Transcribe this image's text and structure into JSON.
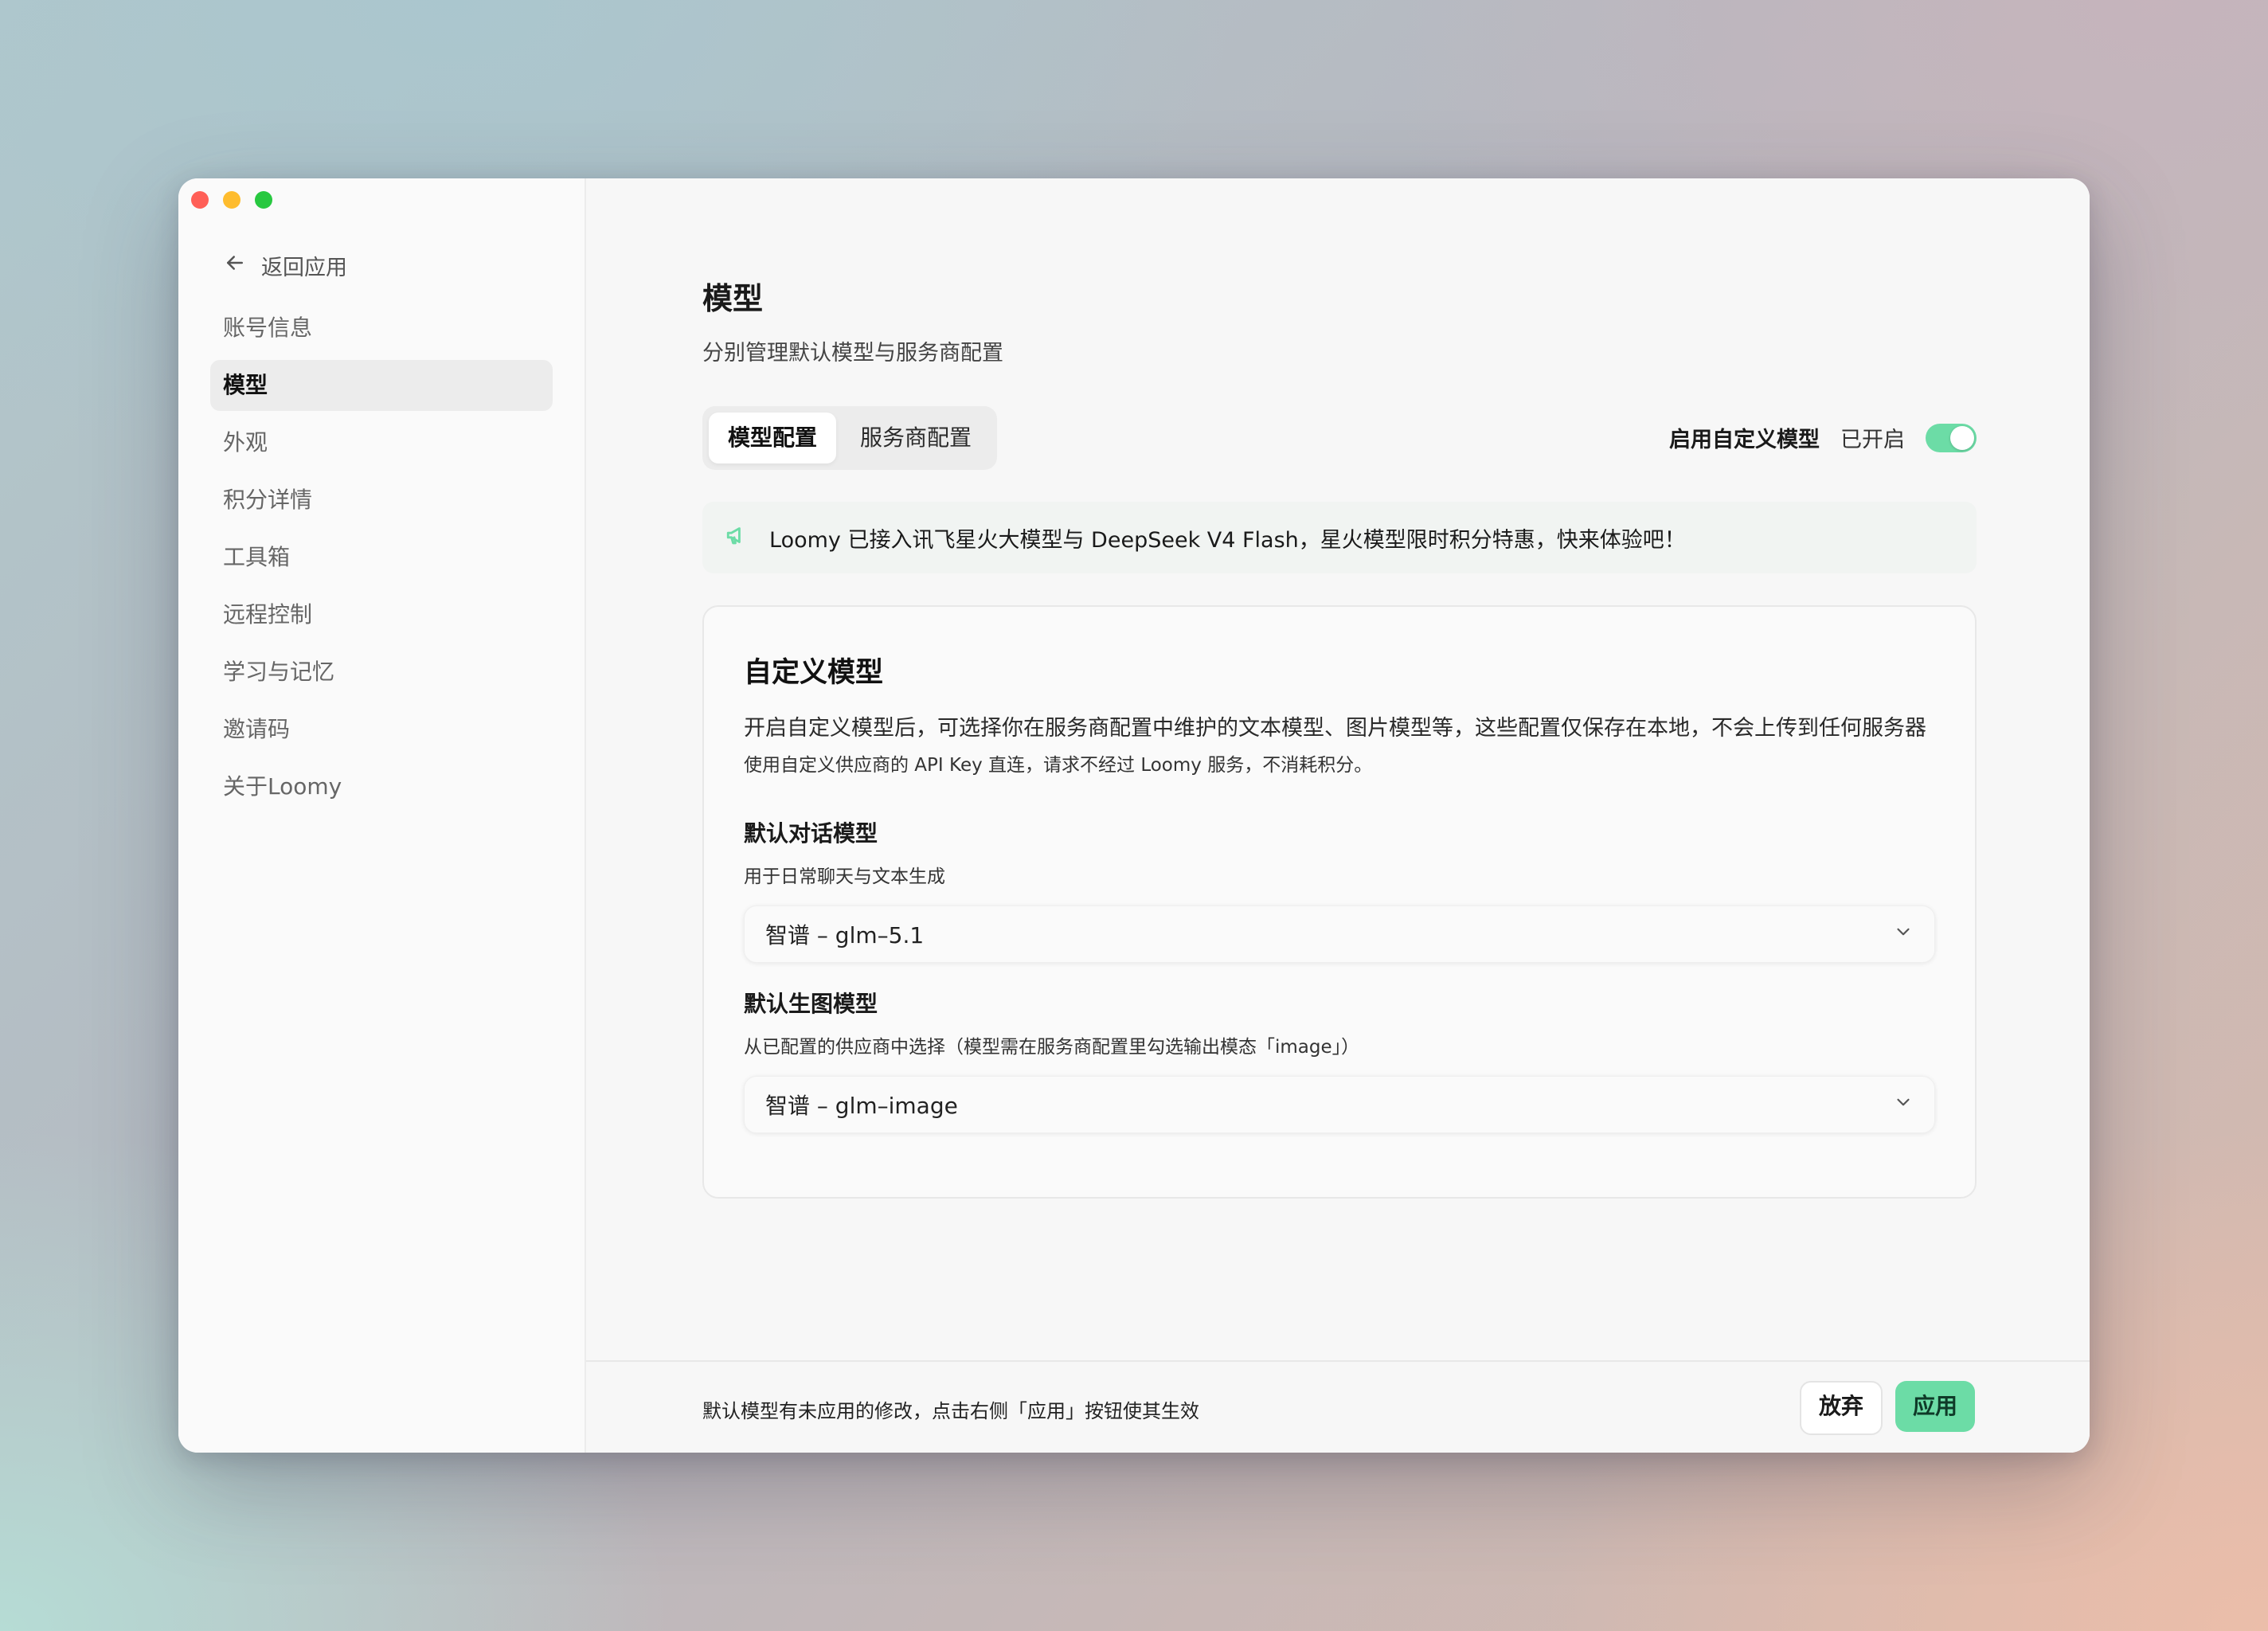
{
  "sidebar": {
    "back_label": "返回应用",
    "items": [
      {
        "label": "账号信息"
      },
      {
        "label": "模型"
      },
      {
        "label": "外观"
      },
      {
        "label": "积分详情"
      },
      {
        "label": "工具箱"
      },
      {
        "label": "远程控制"
      },
      {
        "label": "学习与记忆"
      },
      {
        "label": "邀请码"
      },
      {
        "label": "关于Loomy"
      }
    ],
    "active_index": 1
  },
  "header": {
    "title": "模型",
    "subtitle": "分别管理默认模型与服务商配置"
  },
  "tabs": [
    {
      "label": "模型配置",
      "active": true
    },
    {
      "label": "服务商配置",
      "active": false
    }
  ],
  "custom_toggle": {
    "label": "启用自定义模型",
    "state_text": "已开启",
    "enabled": true
  },
  "notice": {
    "icon": "megaphone-icon",
    "text": "Loomy 已接入讯飞星火大模型与 DeepSeek V4 Flash，星火模型限时积分特惠，快来体验吧！"
  },
  "card": {
    "title": "自定义模型",
    "description": "开启自定义模型后，可选择你在服务商配置中维护的文本模型、图片模型等，这些配置仅保存在本地，不会上传到任何服务器",
    "note": "使用自定义供应商的 API Key 直连，请求不经过 Loomy 服务，不消耗积分。",
    "fields": [
      {
        "label": "默认对话模型",
        "help": "用于日常聊天与文本生成",
        "value": "智谱 – glm–5.1"
      },
      {
        "label": "默认生图模型",
        "help": "从已配置的供应商中选择（模型需在服务商配置里勾选输出模态「image」）",
        "value": "智谱 – glm–image"
      }
    ]
  },
  "footer": {
    "message": "默认模型有未应用的修改，点击右侧「应用」按钮使其生效",
    "discard_label": "放弃",
    "apply_label": "应用"
  },
  "colors": {
    "accent": "#6cdca6",
    "traffic_red": "#ff5f57",
    "traffic_yellow": "#febc2e",
    "traffic_green": "#28c840"
  }
}
